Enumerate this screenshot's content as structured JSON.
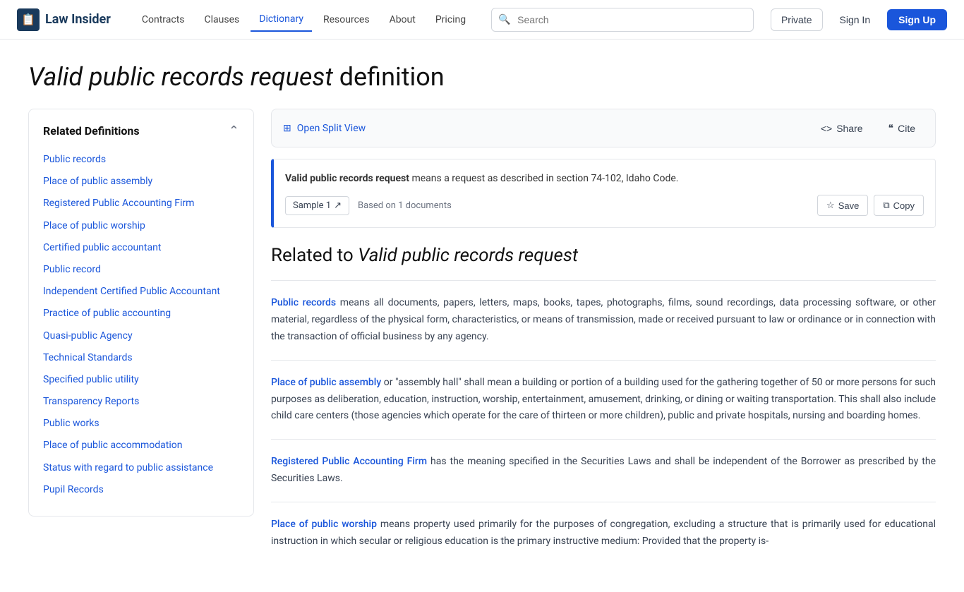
{
  "brand": {
    "name": "Law Insider",
    "icon": "📋"
  },
  "nav": {
    "links": [
      {
        "label": "Contracts",
        "active": false
      },
      {
        "label": "Clauses",
        "active": false
      },
      {
        "label": "Dictionary",
        "active": true
      },
      {
        "label": "Resources",
        "active": false
      },
      {
        "label": "About",
        "active": false
      },
      {
        "label": "Pricing",
        "active": false
      }
    ],
    "search_placeholder": "Search",
    "btn_private": "Private",
    "btn_signin": "Sign In",
    "btn_signup": "Sign Up"
  },
  "page": {
    "title_italic": "Valid public records request",
    "title_suffix": " definition"
  },
  "toolbar": {
    "open_split_view": "Open Split View",
    "share": "Share",
    "cite": "Cite"
  },
  "definition": {
    "term": "Valid public records request",
    "text": " means a request as described in section 74-102, Idaho Code.",
    "sample_label": "Sample 1",
    "based_on": "Based on 1 documents",
    "save_label": "Save",
    "copy_label": "Copy"
  },
  "related": {
    "heading_prefix": "Related to ",
    "heading_italic": "Valid public records request",
    "items": [
      {
        "term": "Public records",
        "term_href": "#",
        "text": " means all documents, papers, letters, maps, books, tapes, photographs, films, sound recordings, data processing software, or other material, regardless of the physical form, characteristics, or means of transmission, made or received pursuant to law or ordinance or in connection with the transaction of official business by any agency."
      },
      {
        "term": "Place of public assembly",
        "term_href": "#",
        "text": " or \"assembly hall\" shall mean a building or portion of a building used for the gathering together of 50 or more persons for such purposes as deliberation, education, instruction, worship, entertainment, amusement, drinking, or dining or waiting transportation. This shall also include child care centers (those agencies which operate for the care of thirteen or more children), public and private hospitals, nursing and boarding homes."
      },
      {
        "term": "Registered Public Accounting Firm",
        "term_href": "#",
        "text": " has the meaning specified in the Securities Laws and shall be independent of the Borrower as prescribed by the Securities Laws."
      },
      {
        "term": "Place of public worship",
        "term_href": "#",
        "text": " means property used primarily for the purposes of congregation, excluding a structure that is primarily used for educational instruction in which secular or religious education is the primary instructive medium: Provided that the property is-"
      }
    ]
  },
  "sidebar": {
    "title": "Related Definitions",
    "items": [
      {
        "label": "Public records"
      },
      {
        "label": "Place of public assembly"
      },
      {
        "label": "Registered Public Accounting Firm"
      },
      {
        "label": "Place of public worship"
      },
      {
        "label": "Certified public accountant"
      },
      {
        "label": "Public record"
      },
      {
        "label": "Independent Certified Public Accountant"
      },
      {
        "label": "Practice of public accounting"
      },
      {
        "label": "Quasi-public Agency"
      },
      {
        "label": "Technical Standards"
      },
      {
        "label": "Specified public utility"
      },
      {
        "label": "Transparency Reports"
      },
      {
        "label": "Public works"
      },
      {
        "label": "Place of public accommodation"
      },
      {
        "label": "Status with regard to public assistance"
      },
      {
        "label": "Pupil Records"
      }
    ]
  }
}
